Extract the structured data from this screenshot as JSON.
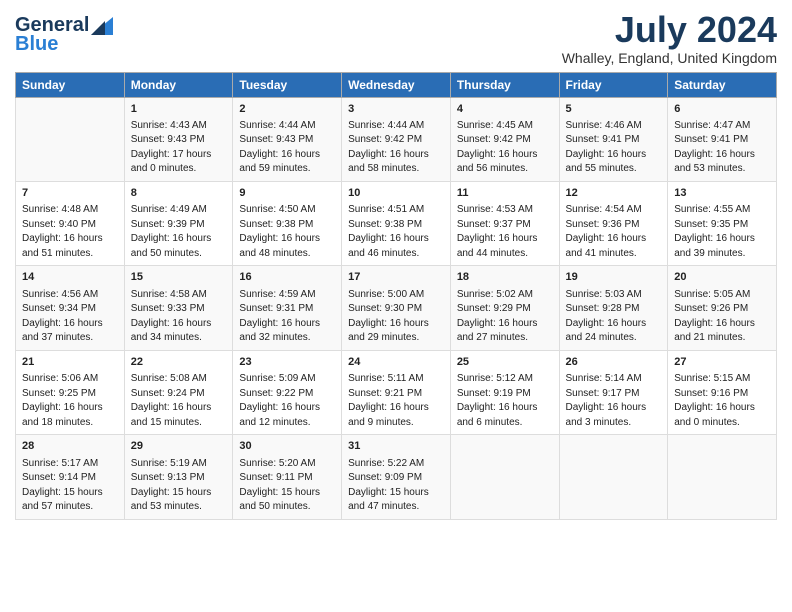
{
  "header": {
    "logo_general": "General",
    "logo_blue": "Blue",
    "month_year": "July 2024",
    "location": "Whalley, England, United Kingdom"
  },
  "days_of_week": [
    "Sunday",
    "Monday",
    "Tuesday",
    "Wednesday",
    "Thursday",
    "Friday",
    "Saturday"
  ],
  "weeks": [
    [
      {
        "day": "",
        "content": ""
      },
      {
        "day": "1",
        "content": "Sunrise: 4:43 AM\nSunset: 9:43 PM\nDaylight: 17 hours\nand 0 minutes."
      },
      {
        "day": "2",
        "content": "Sunrise: 4:44 AM\nSunset: 9:43 PM\nDaylight: 16 hours\nand 59 minutes."
      },
      {
        "day": "3",
        "content": "Sunrise: 4:44 AM\nSunset: 9:42 PM\nDaylight: 16 hours\nand 58 minutes."
      },
      {
        "day": "4",
        "content": "Sunrise: 4:45 AM\nSunset: 9:42 PM\nDaylight: 16 hours\nand 56 minutes."
      },
      {
        "day": "5",
        "content": "Sunrise: 4:46 AM\nSunset: 9:41 PM\nDaylight: 16 hours\nand 55 minutes."
      },
      {
        "day": "6",
        "content": "Sunrise: 4:47 AM\nSunset: 9:41 PM\nDaylight: 16 hours\nand 53 minutes."
      }
    ],
    [
      {
        "day": "7",
        "content": "Sunrise: 4:48 AM\nSunset: 9:40 PM\nDaylight: 16 hours\nand 51 minutes."
      },
      {
        "day": "8",
        "content": "Sunrise: 4:49 AM\nSunset: 9:39 PM\nDaylight: 16 hours\nand 50 minutes."
      },
      {
        "day": "9",
        "content": "Sunrise: 4:50 AM\nSunset: 9:38 PM\nDaylight: 16 hours\nand 48 minutes."
      },
      {
        "day": "10",
        "content": "Sunrise: 4:51 AM\nSunset: 9:38 PM\nDaylight: 16 hours\nand 46 minutes."
      },
      {
        "day": "11",
        "content": "Sunrise: 4:53 AM\nSunset: 9:37 PM\nDaylight: 16 hours\nand 44 minutes."
      },
      {
        "day": "12",
        "content": "Sunrise: 4:54 AM\nSunset: 9:36 PM\nDaylight: 16 hours\nand 41 minutes."
      },
      {
        "day": "13",
        "content": "Sunrise: 4:55 AM\nSunset: 9:35 PM\nDaylight: 16 hours\nand 39 minutes."
      }
    ],
    [
      {
        "day": "14",
        "content": "Sunrise: 4:56 AM\nSunset: 9:34 PM\nDaylight: 16 hours\nand 37 minutes."
      },
      {
        "day": "15",
        "content": "Sunrise: 4:58 AM\nSunset: 9:33 PM\nDaylight: 16 hours\nand 34 minutes."
      },
      {
        "day": "16",
        "content": "Sunrise: 4:59 AM\nSunset: 9:31 PM\nDaylight: 16 hours\nand 32 minutes."
      },
      {
        "day": "17",
        "content": "Sunrise: 5:00 AM\nSunset: 9:30 PM\nDaylight: 16 hours\nand 29 minutes."
      },
      {
        "day": "18",
        "content": "Sunrise: 5:02 AM\nSunset: 9:29 PM\nDaylight: 16 hours\nand 27 minutes."
      },
      {
        "day": "19",
        "content": "Sunrise: 5:03 AM\nSunset: 9:28 PM\nDaylight: 16 hours\nand 24 minutes."
      },
      {
        "day": "20",
        "content": "Sunrise: 5:05 AM\nSunset: 9:26 PM\nDaylight: 16 hours\nand 21 minutes."
      }
    ],
    [
      {
        "day": "21",
        "content": "Sunrise: 5:06 AM\nSunset: 9:25 PM\nDaylight: 16 hours\nand 18 minutes."
      },
      {
        "day": "22",
        "content": "Sunrise: 5:08 AM\nSunset: 9:24 PM\nDaylight: 16 hours\nand 15 minutes."
      },
      {
        "day": "23",
        "content": "Sunrise: 5:09 AM\nSunset: 9:22 PM\nDaylight: 16 hours\nand 12 minutes."
      },
      {
        "day": "24",
        "content": "Sunrise: 5:11 AM\nSunset: 9:21 PM\nDaylight: 16 hours\nand 9 minutes."
      },
      {
        "day": "25",
        "content": "Sunrise: 5:12 AM\nSunset: 9:19 PM\nDaylight: 16 hours\nand 6 minutes."
      },
      {
        "day": "26",
        "content": "Sunrise: 5:14 AM\nSunset: 9:17 PM\nDaylight: 16 hours\nand 3 minutes."
      },
      {
        "day": "27",
        "content": "Sunrise: 5:15 AM\nSunset: 9:16 PM\nDaylight: 16 hours\nand 0 minutes."
      }
    ],
    [
      {
        "day": "28",
        "content": "Sunrise: 5:17 AM\nSunset: 9:14 PM\nDaylight: 15 hours\nand 57 minutes."
      },
      {
        "day": "29",
        "content": "Sunrise: 5:19 AM\nSunset: 9:13 PM\nDaylight: 15 hours\nand 53 minutes."
      },
      {
        "day": "30",
        "content": "Sunrise: 5:20 AM\nSunset: 9:11 PM\nDaylight: 15 hours\nand 50 minutes."
      },
      {
        "day": "31",
        "content": "Sunrise: 5:22 AM\nSunset: 9:09 PM\nDaylight: 15 hours\nand 47 minutes."
      },
      {
        "day": "",
        "content": ""
      },
      {
        "day": "",
        "content": ""
      },
      {
        "day": "",
        "content": ""
      }
    ]
  ]
}
